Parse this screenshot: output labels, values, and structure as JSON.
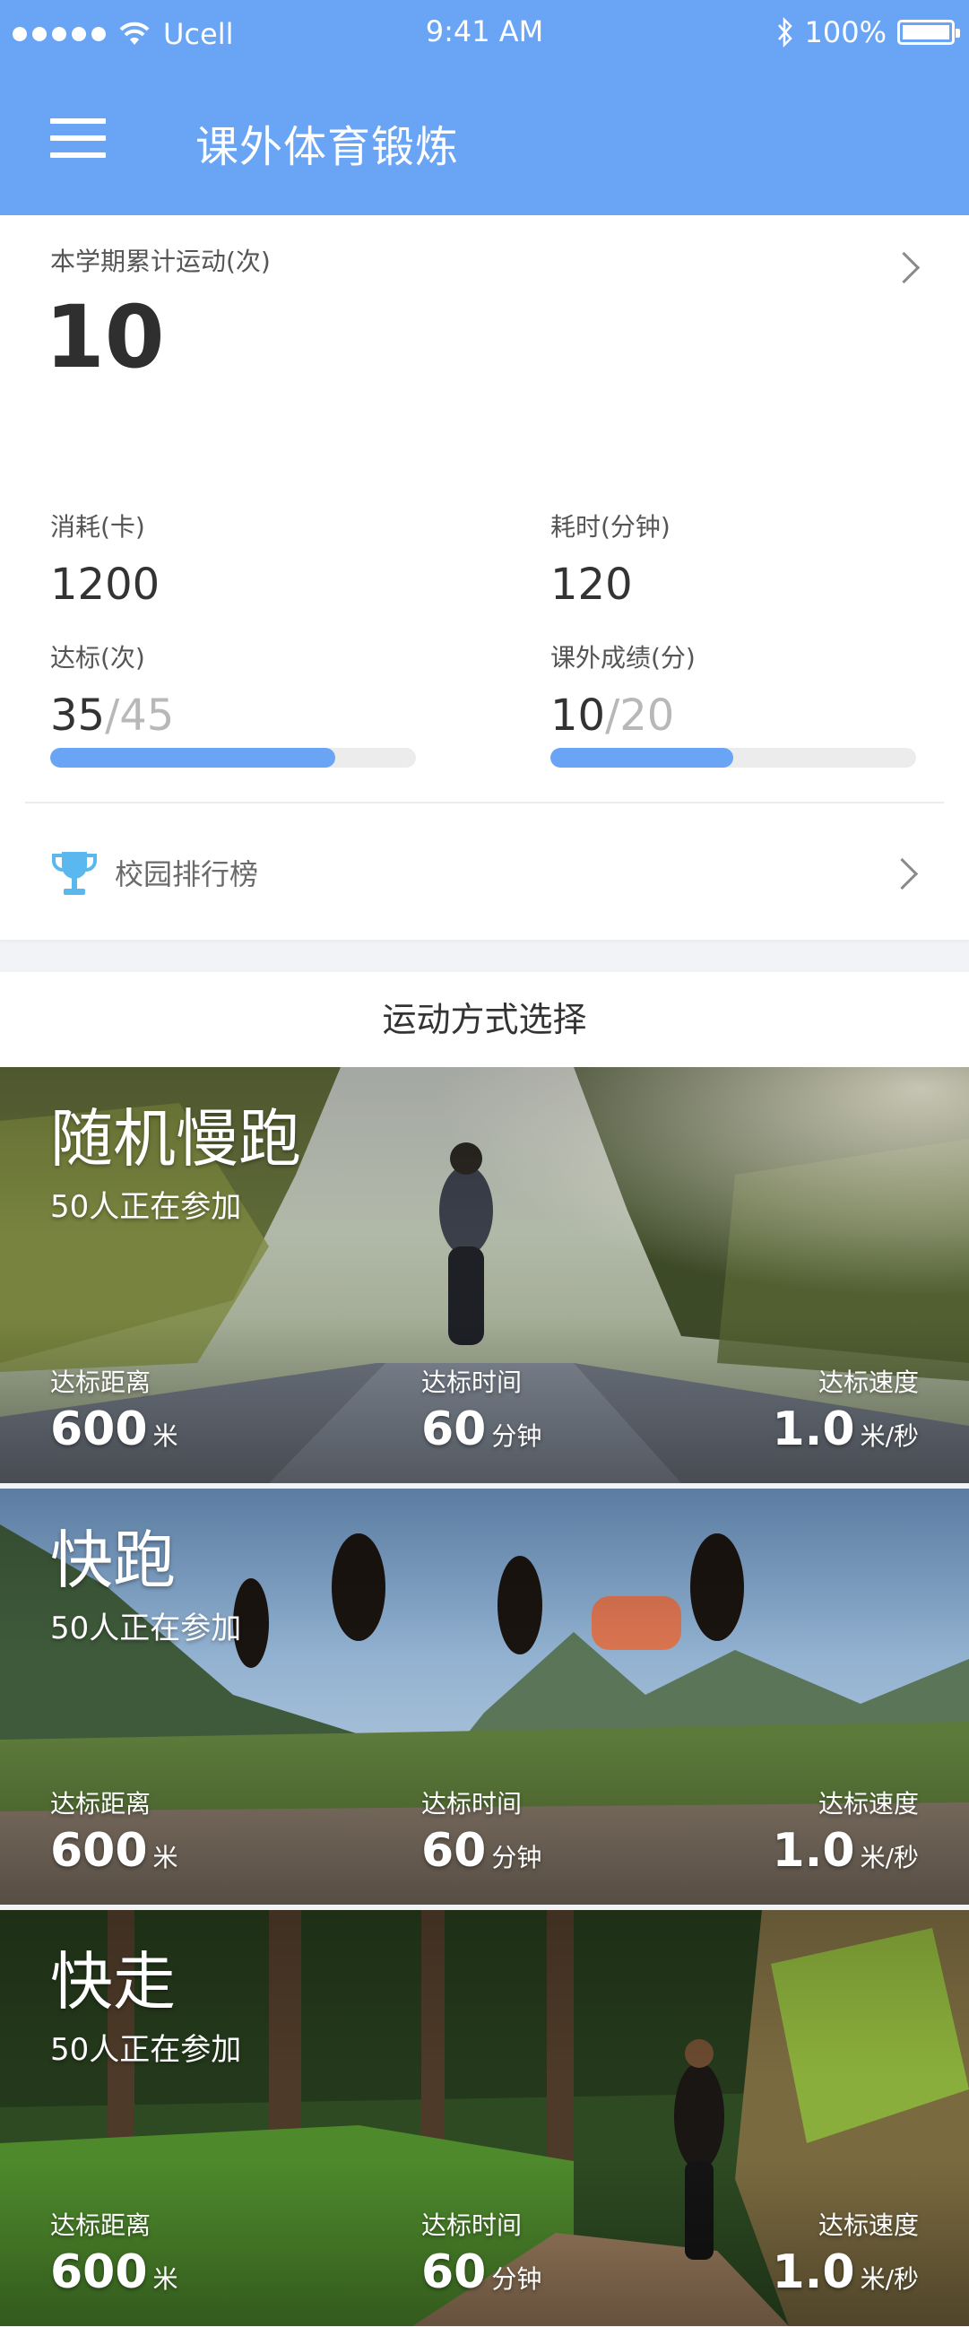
{
  "status_bar": {
    "carrier": "Ucell",
    "time": "9:41 AM",
    "battery": "100%"
  },
  "nav": {
    "title": "课外体育锻炼"
  },
  "summary": {
    "label": "本学期累计运动(次)",
    "value": "10"
  },
  "stats": {
    "calories": {
      "label": "消耗(卡)",
      "value": "1200"
    },
    "duration": {
      "label": "耗时(分钟)",
      "value": "120"
    },
    "qualified": {
      "label": "达标(次)",
      "value": "35",
      "total": "/45",
      "progress": 0.78
    },
    "score": {
      "label": "课外成绩(分)",
      "value": "10",
      "total": "/20",
      "progress": 0.5
    }
  },
  "ranking": {
    "label": "校园排行榜"
  },
  "section": {
    "title": "运动方式选择"
  },
  "sports": [
    {
      "title": "随机慢跑",
      "participants": "50人正在参加",
      "distance_label": "达标距离",
      "distance": "600",
      "distance_unit": "米",
      "time_label": "达标时间",
      "time": "60",
      "time_unit": "分钟",
      "speed_label": "达标速度",
      "speed": "1.0",
      "speed_unit": "米/秒"
    },
    {
      "title": "快跑",
      "participants": "50人正在参加",
      "distance_label": "达标距离",
      "distance": "600",
      "distance_unit": "米",
      "time_label": "达标时间",
      "time": "60",
      "time_unit": "分钟",
      "speed_label": "达标速度",
      "speed": "1.0",
      "speed_unit": "米/秒"
    },
    {
      "title": "快走",
      "participants": "50人正在参加",
      "distance_label": "达标距离",
      "distance": "600",
      "distance_unit": "米",
      "time_label": "达标时间",
      "time": "60",
      "time_unit": "分钟",
      "speed_label": "达标速度",
      "speed": "1.0",
      "speed_unit": "米/秒"
    }
  ],
  "colors": {
    "primary": "#6aa5f5",
    "trophy": "#5ab8ef",
    "track": "#ececec"
  }
}
